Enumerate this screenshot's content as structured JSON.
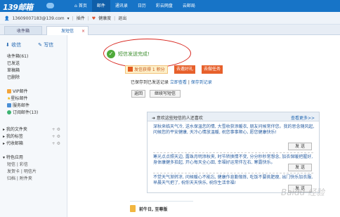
{
  "brand": {
    "logo_text": "139邮箱"
  },
  "nav": {
    "items": [
      {
        "label": "首页",
        "icon": "home-icon"
      },
      {
        "label": "邮件"
      },
      {
        "label": "通讯录"
      },
      {
        "label": "日历"
      },
      {
        "label": "彩云网盘"
      },
      {
        "label": "云邮局"
      }
    ],
    "home_glyph": "⌂"
  },
  "account": {
    "email": "13609007183@139.com",
    "dropdown": "▾",
    "plugin": "插件",
    "health": "健康度",
    "logout": "退出"
  },
  "tabs": [
    {
      "label": "收件箱"
    },
    {
      "label": "发短信",
      "close": "×"
    }
  ],
  "sidebar": {
    "receive_label": "收信",
    "write_label": "写信",
    "folders": [
      {
        "label": "收件箱(61)"
      },
      {
        "label": "已发送"
      },
      {
        "label": "草稿箱"
      },
      {
        "label": "已删除"
      },
      {
        "label": "VIP邮件"
      },
      {
        "label": "星标邮件"
      },
      {
        "label": "服务邮件"
      },
      {
        "label": "订阅邮件(13)"
      }
    ],
    "groups": [
      {
        "label": "我的文件夹",
        "tools": "+ ⚙"
      },
      {
        "label": "我的标签",
        "tools": "+ ⚙"
      },
      {
        "label": "代收邮箱",
        "tools": "+ ⚙"
      }
    ],
    "apps": {
      "title": "特色应用",
      "rows": [
        "短信 | 彩信",
        "发贺卡 | 明信片",
        "归档 | 附件夹"
      ]
    }
  },
  "main": {
    "success_text": "短信发送完成!",
    "check_glyph": "✓",
    "promo_points": "发信获得 1 积分",
    "promo_friend": "去邀好礼",
    "promo_task": "去做任务",
    "saved_prefix": "已保存到已发送记录",
    "saved_link1": "立即查看",
    "saved_link2": "保存到记录",
    "back_button": "返回",
    "next_button": "继续写短信"
  },
  "panel": {
    "title": "➜ 意欢这些短信的人还喜欢",
    "more": "查看更多>>",
    "cards": [
      {
        "text": "深秋来临天气冷, 送水保温您的情, 大雪收获添暖衣, 朋友问候常伴您。我的思念随风起, 问候您的平安健康, 天冷心情放温暖, 祝您事事顺心, 愿您健康快乐!",
        "send": "发 送"
      },
      {
        "text": "寒光点点照天边, 露珠月明添秋夹, 时节转换情不变, 分分秒秒常想念, 加衣保暖把握好, 身体康健多拾起, 开心每天全心田, 幸福好运常伴左右, 寒露快乐。",
        "send": "发 送"
      },
      {
        "text": "不觉天气渐转凉, 问候暖心不能忘, 健康作息勤锻炼, 吃饭不要挑肥瘦, 出门快乐加衣服, 早晨天气把了, 祝你天天快乐, 祝你生活幸福!",
        "send": "发 送"
      }
    ]
  },
  "bottom": {
    "title": "前牛日, 至尊版"
  },
  "watermark": "Baidu 经验"
}
